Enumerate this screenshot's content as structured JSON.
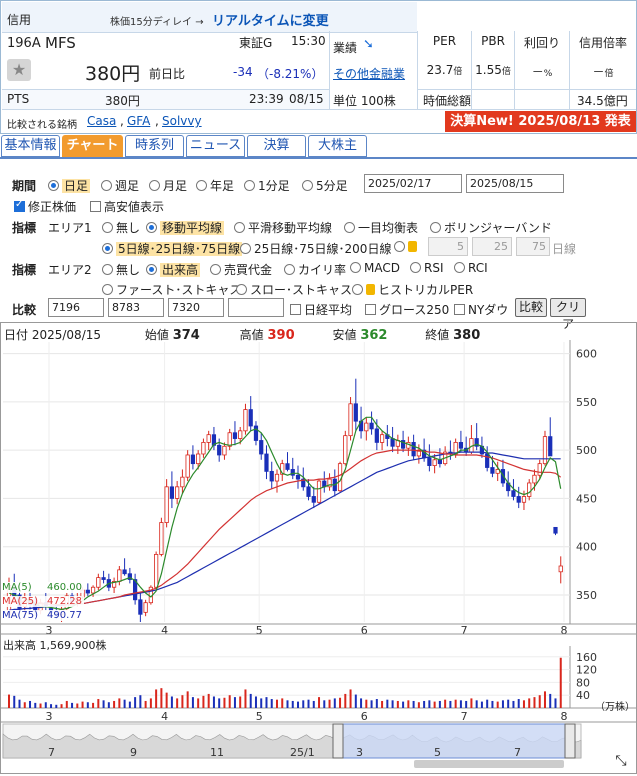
{
  "header": {
    "shinyo": "信用",
    "delay_note": "株価15分ディレイ →",
    "realtime_link": "リアルタイムに変更",
    "code": "196A",
    "name": "MFS",
    "market": "東証G",
    "time": "15:30",
    "price": "380円",
    "prev_label": "前日比",
    "change": "-34",
    "change_pct": "（-8.21%）",
    "pts_label": "PTS",
    "pts_price": "380円",
    "pts_time": "23:39",
    "pts_date": "08/15",
    "gyoseki": "業績",
    "other_link": "その他金融業",
    "unit": "単位 100株",
    "per_label": "PER",
    "per_value": "23.7",
    "per_unit": "倍",
    "pbr_label": "PBR",
    "pbr_value": "1.55",
    "pbr_unit": "倍",
    "yield_label": "利回り",
    "yield_value": "－",
    "yield_unit": "%",
    "margin_label": "信用倍率",
    "margin_value": "－",
    "margin_unit": "倍",
    "mcap_label": "時価総額",
    "mcap_value": "34.5億円",
    "compare_label": "比較される銘柄",
    "compare_1": "Casa",
    "compare_2": "GFA",
    "compare_3": "Solvvy",
    "kessan": "決算New! 2025/08/13 発表"
  },
  "tabs": [
    "基本情報",
    "チャート",
    "時系列",
    "ニュース",
    "決算",
    "大株主"
  ],
  "controls": {
    "kikan_label": "期間",
    "periods": [
      "日足",
      "週足",
      "月足",
      "年足",
      "1分足",
      "5分足"
    ],
    "date_from": "2025/02/17",
    "date_to": "2025/08/15",
    "adjusted": "修正株価",
    "highlow": "高安値表示",
    "shihyo_label": "指標",
    "area1": "エリア1",
    "area1_opts": [
      "無し",
      "移動平均線",
      "平滑移動平均線",
      "一目均衡表",
      "ボリンジャーバンド"
    ],
    "ma_opts": [
      "5日線･25日線･75日線",
      "25日線･75日線･200日線"
    ],
    "ma_custom": [
      "5",
      "25",
      "75"
    ],
    "ma_custom_unit": "日線",
    "area2": "エリア2",
    "area2_opts": [
      "無し",
      "出来高",
      "売買代金",
      "カイリ率",
      "MACD",
      "RSI",
      "RCI"
    ],
    "area2_opts2": [
      "ファースト･ストキャス",
      "スロー･ストキャス",
      "ヒストリカルPER"
    ],
    "hikaku_label": "比較",
    "hikaku_codes": [
      "7196",
      "8783",
      "7320",
      ""
    ],
    "hikaku_checks": [
      "日経平均",
      "グロース250",
      "NYダウ"
    ],
    "hikaku_btn": "比較",
    "clear_btn": "クリア"
  },
  "chart_info": {
    "date_label": "日付",
    "date": "2025/08/15",
    "open_label": "始値",
    "open": "374",
    "high_label": "高値",
    "high": "390",
    "low_label": "安値",
    "low": "362",
    "close_label": "終値",
    "close": "380",
    "ma5_label": "MA(5)",
    "ma5": "460.00",
    "ma25_label": "MA(25)",
    "ma25": "472.28",
    "ma75_label": "MA(75)",
    "ma75": "490.77",
    "volume_label": "出来高",
    "volume": "1,569,900株",
    "volume_unit": "（万株）",
    "colors": {
      "up": "#d9261c",
      "down": "#1a2fb8",
      "ma5": "#2b8a2b",
      "ma25": "#d33333",
      "ma75": "#1e2fb0"
    }
  },
  "chart_data": {
    "type": "candlestick",
    "y_ticks": [
      350,
      400,
      450,
      500,
      550,
      600
    ],
    "ylim": [
      322,
      612
    ],
    "x_ticks": [
      "3",
      "4",
      "5",
      "6",
      "7",
      "8"
    ],
    "volume_ticks": [
      40,
      80,
      120,
      160
    ],
    "volume_ylim": [
      0,
      175
    ],
    "ohlc": [
      [
        330,
        368,
        326,
        360
      ],
      [
        358,
        372,
        345,
        348
      ],
      [
        350,
        355,
        330,
        336
      ],
      [
        338,
        352,
        325,
        344
      ],
      [
        345,
        356,
        335,
        340
      ],
      [
        342,
        348,
        328,
        333
      ],
      [
        334,
        346,
        330,
        342
      ],
      [
        342,
        352,
        334,
        338
      ],
      [
        336,
        345,
        328,
        332
      ],
      [
        333,
        340,
        325,
        329
      ],
      [
        330,
        338,
        322,
        335
      ],
      [
        336,
        352,
        334,
        349
      ],
      [
        349,
        356,
        340,
        343
      ],
      [
        343,
        352,
        338,
        347
      ],
      [
        348,
        358,
        346,
        355
      ],
      [
        355,
        362,
        349,
        352
      ],
      [
        352,
        360,
        348,
        358
      ],
      [
        358,
        372,
        355,
        368
      ],
      [
        368,
        375,
        362,
        366
      ],
      [
        366,
        372,
        354,
        358
      ],
      [
        358,
        368,
        352,
        364
      ],
      [
        364,
        380,
        360,
        376
      ],
      [
        376,
        388,
        370,
        372
      ],
      [
        372,
        378,
        362,
        366
      ],
      [
        366,
        372,
        340,
        345
      ],
      [
        345,
        352,
        322,
        330
      ],
      [
        332,
        345,
        328,
        342
      ],
      [
        342,
        360,
        340,
        358
      ],
      [
        358,
        395,
        355,
        392
      ],
      [
        392,
        430,
        390,
        425
      ],
      [
        425,
        470,
        420,
        462
      ],
      [
        462,
        478,
        440,
        450
      ],
      [
        450,
        468,
        444,
        462
      ],
      [
        462,
        480,
        455,
        472
      ],
      [
        472,
        500,
        468,
        495
      ],
      [
        495,
        505,
        480,
        486
      ],
      [
        486,
        500,
        480,
        496
      ],
      [
        496,
        512,
        492,
        508
      ],
      [
        508,
        520,
        500,
        516
      ],
      [
        516,
        524,
        500,
        505
      ],
      [
        505,
        512,
        488,
        495
      ],
      [
        495,
        508,
        490,
        504
      ],
      [
        504,
        522,
        500,
        518
      ],
      [
        518,
        530,
        505,
        512
      ],
      [
        512,
        524,
        506,
        520
      ],
      [
        520,
        548,
        516,
        542
      ],
      [
        542,
        556,
        520,
        525
      ],
      [
        525,
        530,
        505,
        510
      ],
      [
        510,
        518,
        490,
        496
      ],
      [
        496,
        505,
        470,
        478
      ],
      [
        478,
        488,
        460,
        468
      ],
      [
        468,
        480,
        456,
        475
      ],
      [
        475,
        490,
        468,
        486
      ],
      [
        486,
        498,
        478,
        480
      ],
      [
        480,
        492,
        470,
        474
      ],
      [
        474,
        484,
        460,
        470
      ],
      [
        470,
        482,
        458,
        462
      ],
      [
        462,
        470,
        448,
        452
      ],
      [
        452,
        462,
        440,
        446
      ],
      [
        446,
        470,
        444,
        468
      ],
      [
        468,
        478,
        456,
        462
      ],
      [
        462,
        476,
        458,
        470
      ],
      [
        470,
        480,
        452,
        458
      ],
      [
        458,
        488,
        456,
        486
      ],
      [
        486,
        520,
        484,
        515
      ],
      [
        515,
        555,
        510,
        548
      ],
      [
        548,
        574,
        520,
        530
      ],
      [
        530,
        545,
        512,
        520
      ],
      [
        520,
        534,
        510,
        528
      ],
      [
        528,
        540,
        516,
        522
      ],
      [
        522,
        532,
        500,
        508
      ],
      [
        508,
        520,
        500,
        516
      ],
      [
        516,
        526,
        504,
        512
      ],
      [
        512,
        524,
        498,
        504
      ],
      [
        504,
        516,
        496,
        510
      ],
      [
        510,
        520,
        498,
        502
      ],
      [
        502,
        514,
        494,
        508
      ],
      [
        508,
        516,
        490,
        494
      ],
      [
        494,
        506,
        486,
        500
      ],
      [
        500,
        512,
        488,
        492
      ],
      [
        492,
        506,
        478,
        484
      ],
      [
        484,
        496,
        476,
        490
      ],
      [
        490,
        502,
        482,
        486
      ],
      [
        486,
        504,
        484,
        498
      ],
      [
        498,
        510,
        490,
        496
      ],
      [
        496,
        512,
        492,
        508
      ],
      [
        508,
        520,
        498,
        502
      ],
      [
        502,
        514,
        494,
        498
      ],
      [
        498,
        526,
        496,
        512
      ],
      [
        512,
        528,
        500,
        504
      ],
      [
        504,
        514,
        492,
        496
      ],
      [
        496,
        504,
        478,
        482
      ],
      [
        482,
        494,
        472,
        476
      ],
      [
        476,
        488,
        468,
        480
      ],
      [
        480,
        490,
        462,
        466
      ],
      [
        466,
        478,
        452,
        458
      ],
      [
        458,
        470,
        448,
        452
      ],
      [
        452,
        462,
        440,
        446
      ],
      [
        446,
        458,
        438,
        452
      ],
      [
        452,
        470,
        448,
        466
      ],
      [
        466,
        480,
        458,
        474
      ],
      [
        474,
        490,
        470,
        486
      ],
      [
        486,
        520,
        484,
        514
      ],
      [
        514,
        534,
        500,
        494
      ],
      [
        420,
        420,
        412,
        414
      ],
      [
        374,
        390,
        362,
        380
      ]
    ],
    "volume": [
      42,
      38,
      26,
      18,
      22,
      16,
      14,
      18,
      12,
      10,
      12,
      22,
      16,
      14,
      20,
      18,
      16,
      28,
      24,
      18,
      22,
      30,
      26,
      20,
      34,
      40,
      22,
      30,
      58,
      62,
      48,
      36,
      30,
      40,
      52,
      34,
      30,
      38,
      44,
      36,
      30,
      32,
      40,
      34,
      36,
      58,
      44,
      36,
      30,
      34,
      28,
      26,
      30,
      24,
      22,
      20,
      24,
      26,
      22,
      34,
      24,
      26,
      30,
      32,
      44,
      58,
      42,
      30,
      26,
      24,
      28,
      22,
      26,
      24,
      22,
      20,
      24,
      22,
      18,
      22,
      24,
      20,
      22,
      26,
      22,
      26,
      24,
      22,
      30,
      24,
      20,
      26,
      22,
      20,
      24,
      26,
      22,
      28,
      24,
      30,
      34,
      40,
      52,
      44,
      30,
      157
    ],
    "ma5": [
      352,
      350,
      348,
      346,
      344,
      341,
      338,
      338,
      337,
      336,
      335,
      336,
      338,
      341,
      344,
      348,
      351,
      354,
      358,
      362,
      363,
      364,
      366,
      368,
      365,
      358,
      352,
      348,
      354,
      372,
      396,
      420,
      440,
      455,
      466,
      475,
      482,
      490,
      498,
      506,
      508,
      506,
      505,
      506,
      508,
      514,
      520,
      522,
      518,
      510,
      498,
      486,
      476,
      474,
      476,
      476,
      472,
      466,
      460,
      460,
      462,
      464,
      464,
      468,
      480,
      500,
      520,
      530,
      534,
      534,
      526,
      520,
      516,
      512,
      510,
      508,
      506,
      504,
      502,
      498,
      494,
      492,
      490,
      492,
      494,
      496,
      500,
      500,
      504,
      506,
      504,
      498,
      490,
      482,
      474,
      466,
      460,
      456,
      454,
      456,
      462,
      470,
      482,
      492,
      488,
      460
    ],
    "ma25": [
      344,
      344,
      343,
      343,
      342,
      342,
      341,
      341,
      340,
      340,
      340,
      340,
      340,
      341,
      341,
      342,
      343,
      344,
      345,
      346,
      347,
      348,
      350,
      351,
      352,
      353,
      354,
      355,
      357,
      360,
      364,
      368,
      372,
      377,
      382,
      388,
      394,
      400,
      406,
      412,
      418,
      423,
      428,
      433,
      438,
      443,
      448,
      452,
      455,
      458,
      460,
      462,
      464,
      466,
      467,
      468,
      469,
      469,
      469,
      470,
      470,
      471,
      472,
      474,
      477,
      481,
      485,
      489,
      492,
      495,
      497,
      498,
      499,
      500,
      500,
      500,
      500,
      500,
      499,
      499,
      498,
      498,
      497,
      496,
      496,
      495,
      495,
      495,
      495,
      495,
      494,
      493,
      492,
      490,
      488,
      486,
      484,
      482,
      480,
      479,
      478,
      477,
      477,
      477,
      476,
      472
    ],
    "ma75": [
      334,
      335,
      335,
      336,
      336,
      337,
      337,
      338,
      338,
      339,
      339,
      340,
      340,
      341,
      341,
      342,
      343,
      344,
      345,
      346,
      347,
      348,
      349,
      350,
      351,
      352,
      353,
      354,
      355,
      357,
      359,
      361,
      363,
      366,
      369,
      372,
      375,
      378,
      381,
      384,
      387,
      390,
      393,
      396,
      399,
      402,
      405,
      408,
      411,
      414,
      417,
      420,
      423,
      426,
      429,
      432,
      435,
      438,
      441,
      444,
      447,
      450,
      453,
      456,
      459,
      462,
      465,
      468,
      471,
      474,
      477,
      479,
      481,
      483,
      485,
      487,
      489,
      490,
      491,
      492,
      493,
      494,
      495,
      496,
      497,
      497,
      498,
      498,
      498,
      498,
      498,
      497,
      497,
      496,
      495,
      494,
      493,
      492,
      491,
      491,
      491,
      491,
      491,
      491,
      491,
      491
    ],
    "navigator": {
      "labels": [
        "7",
        "9",
        "11",
        "25/1",
        "3",
        "5",
        "7"
      ]
    }
  }
}
